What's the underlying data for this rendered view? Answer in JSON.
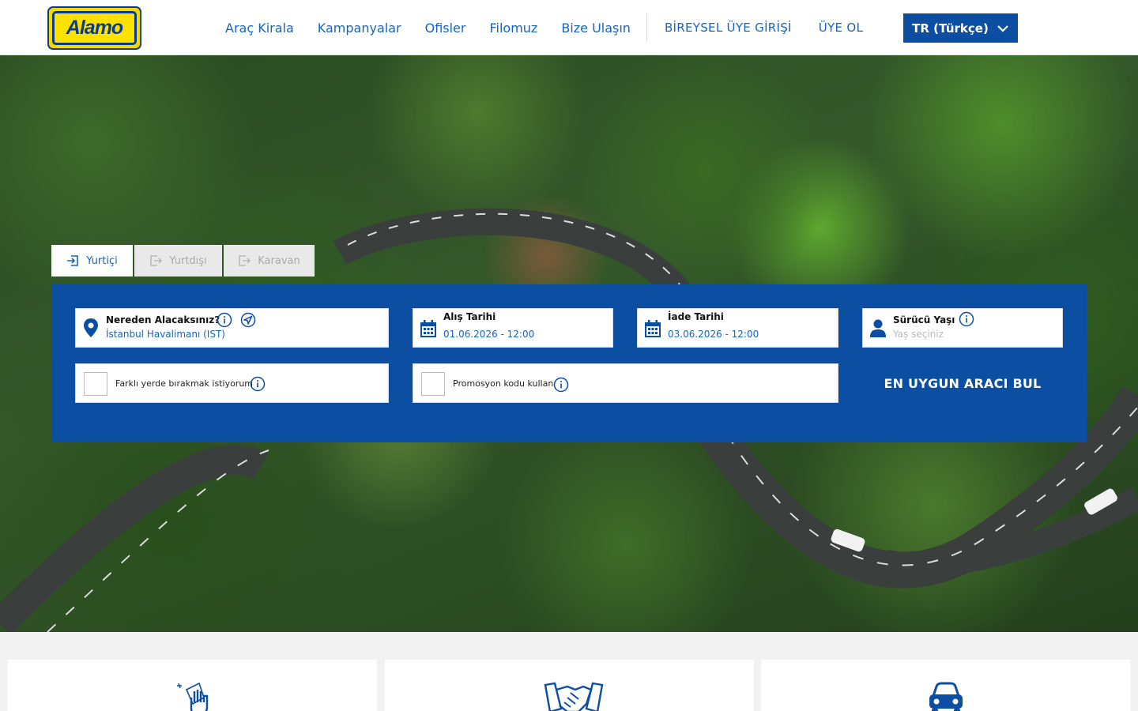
{
  "brand": {
    "logo_text": "Alamo",
    "primary_color": "#0b4ea2",
    "link_color": "#1565c0",
    "logo_yellow": "#ffe100"
  },
  "nav": {
    "items": [
      "Araç Kirala",
      "Kampanyalar",
      "Ofisler",
      "Filomuz",
      "Bize Ulaşın"
    ],
    "login": "BİREYSEL ÜYE GİRİŞİ",
    "signup": "ÜYE OL",
    "language": "TR (Türkçe)"
  },
  "tabs": [
    {
      "label": "Yurtiçi",
      "active": true
    },
    {
      "label": "Yurtdışı",
      "active": false
    },
    {
      "label": "Karavan",
      "active": false
    }
  ],
  "search": {
    "pickup": {
      "label": "Nereden Alacaksınız?",
      "value": "İstanbul Havalimanı (IST)"
    },
    "pickup_date": {
      "label": "Alış Tarihi",
      "value": "01.06.2026 - 12:00"
    },
    "return_date": {
      "label": "İade Tarihi",
      "value": "03.06.2026 - 12:00"
    },
    "driver_age": {
      "label": "Sürücü Yaşı",
      "placeholder": "Yaş seçiniz"
    },
    "different_dropoff": "Farklı yerde bırakmak istiyorum",
    "promo_code": "Promosyon kodu kullan",
    "submit": "EN UYGUN ARACI BUL"
  }
}
